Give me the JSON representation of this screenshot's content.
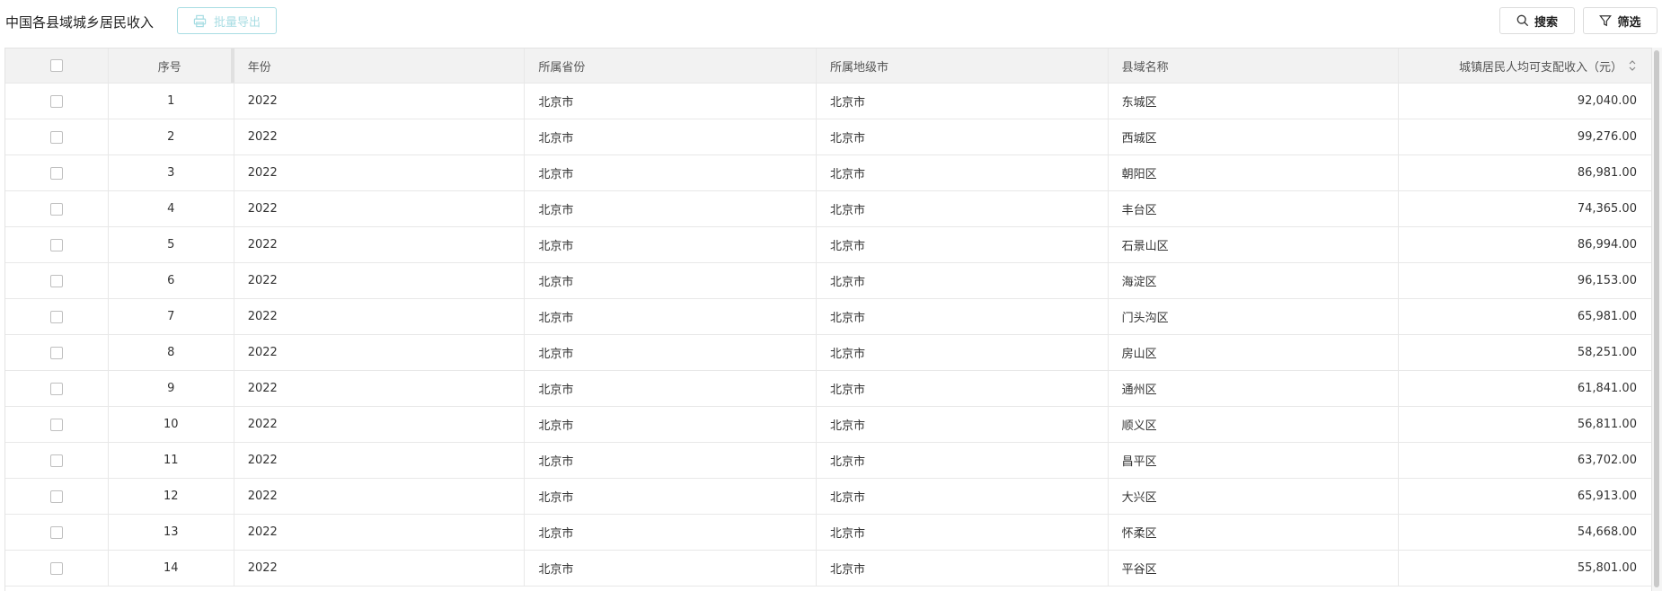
{
  "header": {
    "title": "中国各县域城乡居民收入",
    "export_label": "批量导出",
    "search_label": "搜索",
    "filter_label": "筛选"
  },
  "table": {
    "columns": {
      "index": "序号",
      "year": "年份",
      "province": "所属省份",
      "city": "所属地级市",
      "county": "县域名称",
      "income": "城镇居民人均可支配收入（元）"
    },
    "rows": [
      {
        "index": "1",
        "year": "2022",
        "province": "北京市",
        "city": "北京市",
        "county": "东城区",
        "income": "92,040.00"
      },
      {
        "index": "2",
        "year": "2022",
        "province": "北京市",
        "city": "北京市",
        "county": "西城区",
        "income": "99,276.00"
      },
      {
        "index": "3",
        "year": "2022",
        "province": "北京市",
        "city": "北京市",
        "county": "朝阳区",
        "income": "86,981.00"
      },
      {
        "index": "4",
        "year": "2022",
        "province": "北京市",
        "city": "北京市",
        "county": "丰台区",
        "income": "74,365.00"
      },
      {
        "index": "5",
        "year": "2022",
        "province": "北京市",
        "city": "北京市",
        "county": "石景山区",
        "income": "86,994.00"
      },
      {
        "index": "6",
        "year": "2022",
        "province": "北京市",
        "city": "北京市",
        "county": "海淀区",
        "income": "96,153.00"
      },
      {
        "index": "7",
        "year": "2022",
        "province": "北京市",
        "city": "北京市",
        "county": "门头沟区",
        "income": "65,981.00"
      },
      {
        "index": "8",
        "year": "2022",
        "province": "北京市",
        "city": "北京市",
        "county": "房山区",
        "income": "58,251.00"
      },
      {
        "index": "9",
        "year": "2022",
        "province": "北京市",
        "city": "北京市",
        "county": "通州区",
        "income": "61,841.00"
      },
      {
        "index": "10",
        "year": "2022",
        "province": "北京市",
        "city": "北京市",
        "county": "顺义区",
        "income": "56,811.00"
      },
      {
        "index": "11",
        "year": "2022",
        "province": "北京市",
        "city": "北京市",
        "county": "昌平区",
        "income": "63,702.00"
      },
      {
        "index": "12",
        "year": "2022",
        "province": "北京市",
        "city": "北京市",
        "county": "大兴区",
        "income": "65,913.00"
      },
      {
        "index": "13",
        "year": "2022",
        "province": "北京市",
        "city": "北京市",
        "county": "怀柔区",
        "income": "54,668.00"
      },
      {
        "index": "14",
        "year": "2022",
        "province": "北京市",
        "city": "北京市",
        "county": "平谷区",
        "income": "55,801.00"
      }
    ]
  },
  "icons": {
    "export": "printer-icon",
    "search": "search-icon",
    "filter": "filter-icon",
    "sort": "sort-icon"
  },
  "colors": {
    "export_button_disabled": "#a8dde3",
    "header_bg": "#f2f2f2",
    "border": "#e8e8e8"
  }
}
